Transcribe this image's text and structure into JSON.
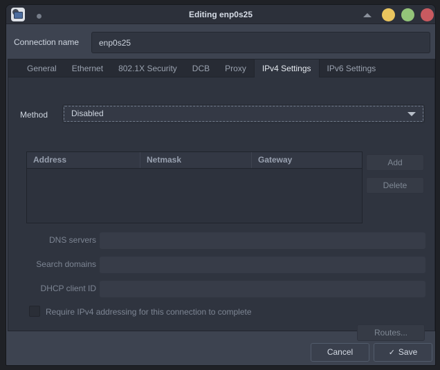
{
  "titlebar": {
    "title": "Editing enp0s25",
    "window_buttons": [
      {
        "name": "minimize",
        "color": "#eac55e"
      },
      {
        "name": "maximize",
        "color": "#93c479"
      },
      {
        "name": "close",
        "color": "#c85a60"
      }
    ]
  },
  "connection": {
    "label": "Connection name",
    "value": "enp0s25"
  },
  "tabs": [
    {
      "label": "General",
      "active": false
    },
    {
      "label": "Ethernet",
      "active": false
    },
    {
      "label": "802.1X Security",
      "active": false
    },
    {
      "label": "DCB",
      "active": false
    },
    {
      "label": "Proxy",
      "active": false
    },
    {
      "label": "IPv4 Settings",
      "active": true
    },
    {
      "label": "IPv6 Settings",
      "active": false
    }
  ],
  "ipv4": {
    "method_label": "Method",
    "method_value": "Disabled",
    "table": {
      "columns": [
        "Address",
        "Netmask",
        "Gateway"
      ],
      "rows": []
    },
    "add_label": "Add",
    "delete_label": "Delete",
    "fields": [
      {
        "label": "DNS servers",
        "value": "",
        "enabled": false
      },
      {
        "label": "Search domains",
        "value": "",
        "enabled": false
      },
      {
        "label": "DHCP client ID",
        "value": "",
        "enabled": false
      }
    ],
    "checkbox": {
      "label": "Require IPv4 addressing for this connection to complete",
      "checked": false
    },
    "routes_label": "Routes..."
  },
  "actions": {
    "cancel": "Cancel",
    "save": "Save",
    "save_icon_glyph": "✓"
  },
  "colors": {
    "window_bg": "#3d4350",
    "titlebar_bg": "#2c303a",
    "notebook_page_bg": "#2f343f",
    "tabstrip_bg": "#272b34",
    "entry_bg": "#303540",
    "disabled_entry_bg": "#373c48",
    "text": "#cfd6e0",
    "disabled_text": "#7d8593"
  }
}
